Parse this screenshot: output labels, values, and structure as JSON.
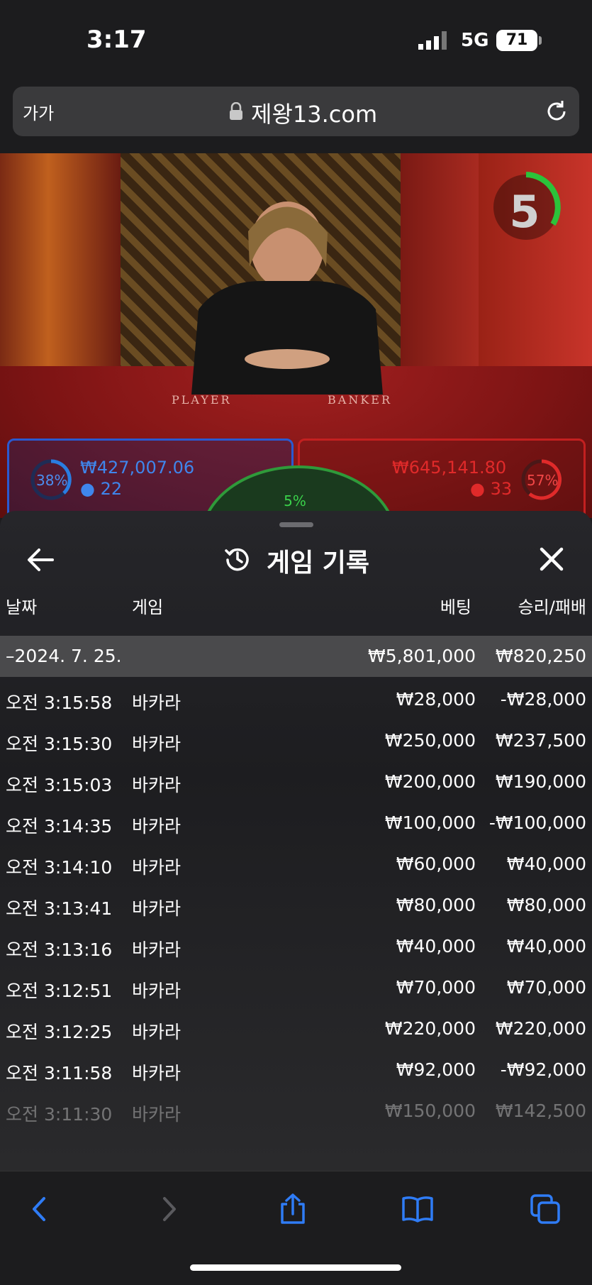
{
  "status": {
    "time": "3:17",
    "network": "5G",
    "battery": "71"
  },
  "browser": {
    "text_size_label": "가가",
    "url": "제왕13.com"
  },
  "video": {
    "countdown": "5",
    "table_labels": {
      "player": "PLAYER",
      "banker": "BANKER"
    },
    "player": {
      "percent": "38%",
      "amount": "₩427,007.06",
      "count": "22"
    },
    "banker": {
      "percent": "57%",
      "amount": "₩645,141.80",
      "count": "33"
    },
    "tie": {
      "percent": "5%"
    }
  },
  "sheet": {
    "title": "게임 기록",
    "columns": {
      "date": "날짜",
      "game": "게임",
      "bet": "베팅",
      "result": "승리/패배"
    },
    "date_group": {
      "date": "–2024. 7. 25.",
      "bet_total": "₩5,801,000",
      "result_total": "₩820,250"
    },
    "rows": [
      {
        "time": "오전 3:15:58",
        "game": "바카라",
        "bet": "₩28,000",
        "result": "-₩28,000"
      },
      {
        "time": "오전 3:15:30",
        "game": "바카라",
        "bet": "₩250,000",
        "result": "₩237,500"
      },
      {
        "time": "오전 3:15:03",
        "game": "바카라",
        "bet": "₩200,000",
        "result": "₩190,000"
      },
      {
        "time": "오전 3:14:35",
        "game": "바카라",
        "bet": "₩100,000",
        "result": "-₩100,000"
      },
      {
        "time": "오전 3:14:10",
        "game": "바카라",
        "bet": "₩60,000",
        "result": "₩40,000"
      },
      {
        "time": "오전 3:13:41",
        "game": "바카라",
        "bet": "₩80,000",
        "result": "₩80,000"
      },
      {
        "time": "오전 3:13:16",
        "game": "바카라",
        "bet": "₩40,000",
        "result": "₩40,000"
      },
      {
        "time": "오전 3:12:51",
        "game": "바카라",
        "bet": "₩70,000",
        "result": "₩70,000"
      },
      {
        "time": "오전 3:12:25",
        "game": "바카라",
        "bet": "₩220,000",
        "result": "₩220,000"
      },
      {
        "time": "오전 3:11:58",
        "game": "바카라",
        "bet": "₩92,000",
        "result": "-₩92,000"
      },
      {
        "time": "오전 3:11:30",
        "game": "바카라",
        "bet": "₩150,000",
        "result": "₩142,500"
      }
    ]
  },
  "icons": {
    "back": "arrow-left-icon",
    "history": "history-icon",
    "close": "close-icon",
    "nav_back": "chevron-left-icon",
    "nav_forward": "chevron-right-icon",
    "share": "share-icon",
    "bookmarks": "book-icon",
    "tabs": "tabs-icon",
    "lock": "lock-icon",
    "reload": "reload-icon"
  },
  "colors": {
    "player": "#2a7de1",
    "banker": "#d32626",
    "tie": "#2fbf3a",
    "toolbar_accent": "#2f7cf6"
  }
}
